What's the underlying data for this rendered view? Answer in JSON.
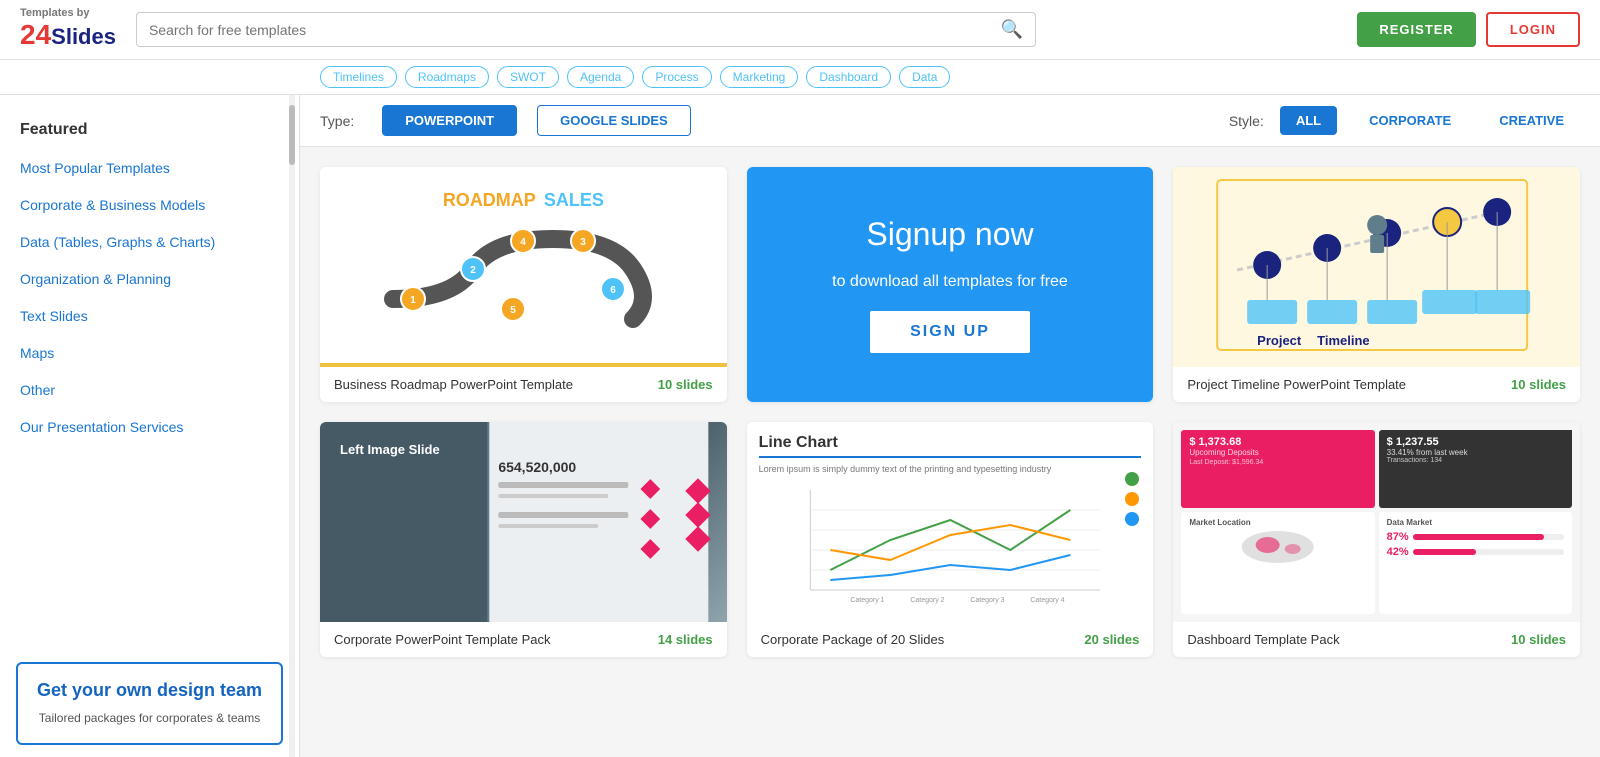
{
  "logo": {
    "by": "Templates by",
    "num": "24",
    "slides": "Slides"
  },
  "header": {
    "search_placeholder": "Search for free templates",
    "register_label": "REGISTER",
    "login_label": "LOGIN"
  },
  "filter_tags": [
    "Timelines",
    "Roadmaps",
    "SWOT",
    "Agenda",
    "Process",
    "Marketing",
    "Dashboard",
    "Data"
  ],
  "sidebar": {
    "items": [
      {
        "label": "Featured",
        "type": "featured"
      },
      {
        "label": "Most Popular Templates",
        "type": "link"
      },
      {
        "label": "Corporate & Business Models",
        "type": "link"
      },
      {
        "label": "Data (Tables, Graphs & Charts)",
        "type": "link"
      },
      {
        "label": "Organization & Planning",
        "type": "link"
      },
      {
        "label": "Text Slides",
        "type": "link"
      },
      {
        "label": "Maps",
        "type": "link"
      },
      {
        "label": "Other",
        "type": "link"
      },
      {
        "label": "Our Presentation Services",
        "type": "link"
      }
    ],
    "promo": {
      "title": "Get your own design team",
      "subtitle": "Tailored packages for corporates & teams"
    }
  },
  "type_bar": {
    "type_label": "Type:",
    "powerpoint_label": "POWERPOINT",
    "google_slides_label": "GOOGLE SLIDES",
    "style_label": "Style:",
    "all_label": "ALL",
    "corporate_label": "CORPORATE",
    "creative_label": "CREATIVE"
  },
  "templates": [
    {
      "name": "Business Roadmap PowerPoint Template",
      "slides": "10 slides",
      "type": "roadmap"
    },
    {
      "name": "signup",
      "slides": "",
      "type": "signup",
      "signup_title": "Signup now",
      "signup_sub": "to download all templates for free",
      "signup_btn": "SIGN UP"
    },
    {
      "name": "Project Timeline PowerPoint Template",
      "slides": "10 slides",
      "type": "timeline"
    },
    {
      "name": "Corporate PowerPoint Template Pack",
      "slides": "14 slides",
      "type": "corp"
    },
    {
      "name": "Corporate Package of 20 Slides",
      "slides": "20 slides",
      "type": "linechart"
    },
    {
      "name": "Dashboard Template Pack",
      "slides": "10 slides",
      "type": "dashboard"
    }
  ]
}
